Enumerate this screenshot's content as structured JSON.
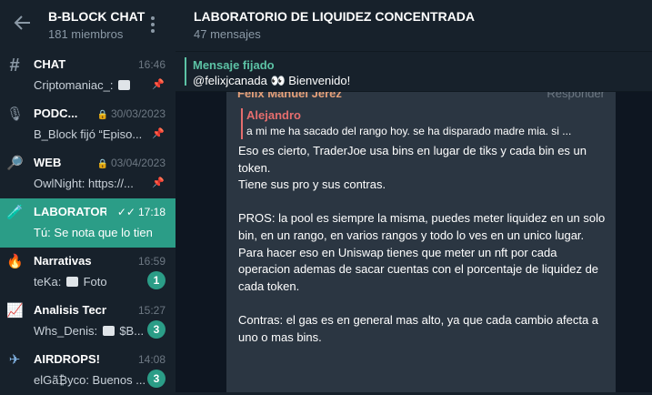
{
  "sidebar": {
    "title": "B-BLOCK CHAT",
    "subtitle": "181 miembros",
    "items": [
      {
        "icon": "hash-icon",
        "glyph": "#",
        "name": "CHAT",
        "time": "16:46",
        "preview": "Criptomaniac_:",
        "preview_extra": "",
        "pinned": true
      },
      {
        "icon": "microphone-icon",
        "glyph": "🎙",
        "name": "PODC...",
        "time": "30/03/2023",
        "preview": "B_Block fijó “Episo...",
        "pinned": true,
        "locked": true
      },
      {
        "icon": "magnifier-icon",
        "glyph": "🔎",
        "name": "WEB",
        "time": "03/04/2023",
        "preview": "OwlNight: https://...",
        "pinned": true,
        "locked": true
      },
      {
        "icon": "test-tube-icon",
        "glyph": "🧪",
        "name": "LABORATOR...",
        "time": "17:18",
        "preview": "Tú: Se  nota que lo tien...",
        "active": true
      },
      {
        "icon": "fire-icon",
        "glyph": "🔥",
        "name": "Narrativas",
        "time": "16:59",
        "preview": "teKa:",
        "preview_extra": "Foto",
        "badge": "1"
      },
      {
        "icon": "chart-icon",
        "glyph": "📈",
        "name": "Analisis Tecnico",
        "time": "15:27",
        "preview": "Whs_Denis:",
        "preview_extra": "$B...",
        "badge": "3"
      },
      {
        "icon": "airplane-icon",
        "glyph": "✈",
        "name": "AIRDROPS!",
        "time": "14:08",
        "preview": "elGã₿yco: Buenos ...",
        "badge": "3"
      }
    ]
  },
  "main": {
    "title": "LABORATORIO DE LIQUIDEZ CONCENTRADA",
    "subtitle": "47 mensajes",
    "pinned": {
      "label": "Mensaje fijado",
      "text": "@felixjcanada 👀 Bienvenido!"
    },
    "message": {
      "author": "Felix Manuel Jerez",
      "reply_label": "Responder",
      "quote_author": "Alejandro",
      "quote_text": "a mi me ha sacado del rango hoy. se ha disparado madre mia. si ...",
      "body": "Eso es cierto, TraderJoe usa bins en lugar de tiks y cada bin es un token.\nTiene sus pro y sus contras.\n\nPROS: la pool es siempre la misma, puedes meter liquidez en un solo bin, en un rango, en varios rangos y todo lo ves en un unico lugar.\nPara hacer eso en Uniswap tienes que meter un nft por cada operacion ademas de sacar cuentas con el porcentaje de liquidez de cada token.\n\nContras: el gas es en general mas alto, ya que cada cambio afecta a uno o mas bins."
    }
  }
}
